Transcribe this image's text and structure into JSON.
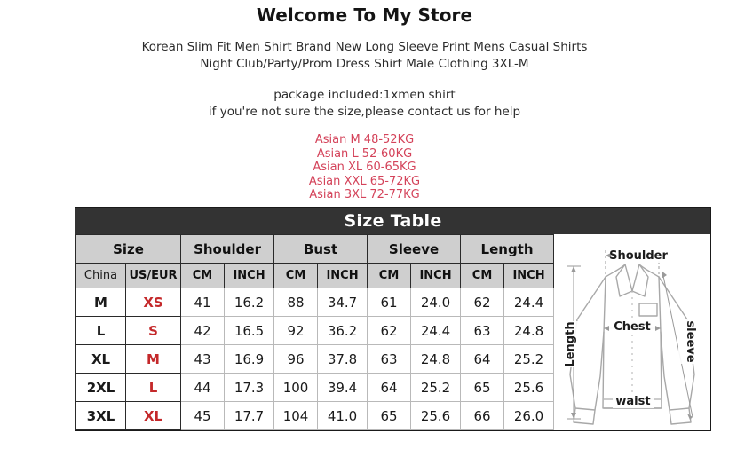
{
  "intro": {
    "store_title": "Welcome To My Store",
    "description_line1": "Korean Slim Fit Men Shirt Brand New Long Sleeve Print Mens Casual Shirts",
    "description_line2": "Night Club/Party/Prom Dress Shirt Male Clothing 3XL-M",
    "package_line1": "package included:1xmen shirt",
    "package_line2": "if you're not sure the size,please contact us for help",
    "weight_guide": [
      "Asian M 48-52KG",
      "Asian L 52-60KG",
      "Asian XL 60-65KG",
      "Asian XXL 65-72KG",
      "Asian 3XL 72-77KG"
    ],
    "weight_guide_color": "#d4435a"
  },
  "size_table": {
    "banner_title": "Size Table",
    "banner_bg": "#333333",
    "header_bg": "#cfcfcf",
    "useur_color": "#c4282a",
    "group_headers": [
      "Size",
      "Shoulder",
      "Bust",
      "Sleeve",
      "Length"
    ],
    "unit_headers": [
      "China",
      "US/EUR",
      "CM",
      "INCH",
      "CM",
      "INCH",
      "CM",
      "INCH",
      "CM",
      "INCH"
    ],
    "rows": [
      {
        "china": "M",
        "useur": "XS",
        "shoulder_cm": "41",
        "shoulder_in": "16.2",
        "bust_cm": "88",
        "bust_in": "34.7",
        "sleeve_cm": "61",
        "sleeve_in": "24.0",
        "length_cm": "62",
        "length_in": "24.4"
      },
      {
        "china": "L",
        "useur": "S",
        "shoulder_cm": "42",
        "shoulder_in": "16.5",
        "bust_cm": "92",
        "bust_in": "36.2",
        "sleeve_cm": "62",
        "sleeve_in": "24.4",
        "length_cm": "63",
        "length_in": "24.8"
      },
      {
        "china": "XL",
        "useur": "M",
        "shoulder_cm": "43",
        "shoulder_in": "16.9",
        "bust_cm": "96",
        "bust_in": "37.8",
        "sleeve_cm": "63",
        "sleeve_in": "24.8",
        "length_cm": "64",
        "length_in": "25.2"
      },
      {
        "china": "2XL",
        "useur": "L",
        "shoulder_cm": "44",
        "shoulder_in": "17.3",
        "bust_cm": "100",
        "bust_in": "39.4",
        "sleeve_cm": "64",
        "sleeve_in": "25.2",
        "length_cm": "65",
        "length_in": "25.6"
      },
      {
        "china": "3XL",
        "useur": "XL",
        "shoulder_cm": "45",
        "shoulder_in": "17.7",
        "bust_cm": "104",
        "bust_in": "41.0",
        "sleeve_cm": "65",
        "sleeve_in": "25.6",
        "length_cm": "66",
        "length_in": "26.0"
      }
    ]
  },
  "diagram": {
    "labels": {
      "shoulder": "Shoulder",
      "chest": "Chest",
      "waist": "waist",
      "length": "Length",
      "sleeve": "sleeve"
    }
  }
}
